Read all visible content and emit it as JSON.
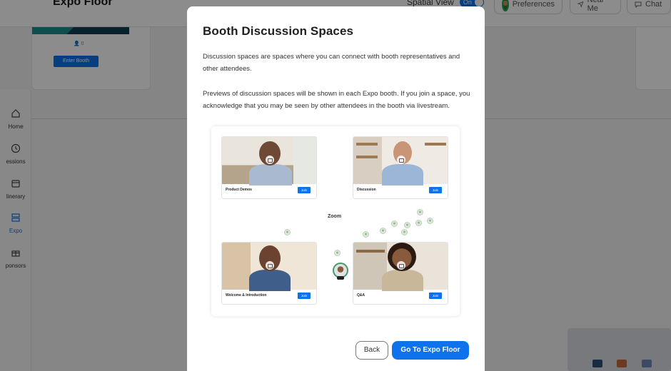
{
  "header": {
    "page_title": "Expo Floor",
    "spatial_view_label": "Spatial View",
    "spatial_view_toggle": "On",
    "preferences_label": "Preferences",
    "near_me_label": "Near Me",
    "chat_label": "Chat"
  },
  "sidebar": {
    "items": [
      {
        "label": "Home",
        "icon": "home-icon"
      },
      {
        "label": "essions",
        "icon": "clock-icon"
      },
      {
        "label": "linerary",
        "icon": "calendar-icon"
      },
      {
        "label": "Expo",
        "icon": "expo-icon",
        "active": true
      },
      {
        "label": "ponsors",
        "icon": "gift-icon"
      }
    ]
  },
  "booth": {
    "attendee_count": "0",
    "enter_label": "Enter Booth"
  },
  "modal": {
    "title": "Booth Discussion Spaces",
    "paragraph1": "Discussion spaces are spaces where you can connect with booth representatives and other attendees.",
    "paragraph2": "Previews of discussion spaces will be shown in each Expo booth. If you join a space, you acknowledge that you may be seen by other attendees in the booth via livestream.",
    "illustration": {
      "center_label": "Zoom",
      "tiles": [
        {
          "caption": "Product Demos",
          "join": "Join"
        },
        {
          "caption": "Discussion",
          "join": "Join"
        },
        {
          "caption": "Welcome & Introduction",
          "join": "Join"
        },
        {
          "caption": "Q&A",
          "join": "Join"
        }
      ]
    },
    "back_label": "Back",
    "primary_label": "Go To Expo Floor"
  },
  "colors": {
    "accent": "#0e72ed",
    "overlay": "#000000"
  }
}
